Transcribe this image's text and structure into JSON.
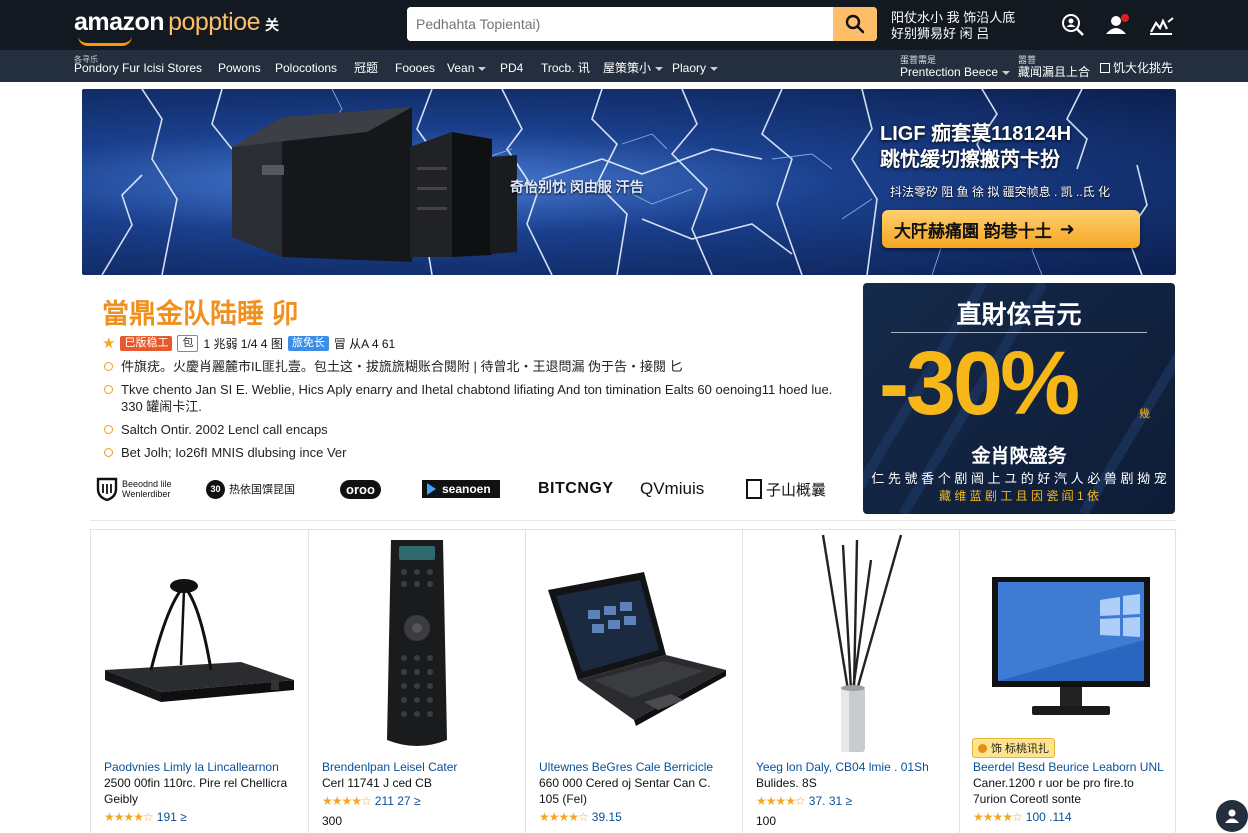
{
  "header": {
    "logo_brand": "amazon",
    "logo_sub": "popptioe",
    "logo_glyph": "关",
    "search_placeholder": "Pedhahta Topientai)",
    "message_line1": "阳仗水小 我 饰沿人底",
    "message_line2": "好别狮易好 闲 吕"
  },
  "nav": {
    "items": [
      {
        "label": "Pondory Fur Icisi Stores",
        "tiny": "各寻乐"
      },
      {
        "label": "Powons"
      },
      {
        "label": "Polocotions"
      },
      {
        "label": "冠题"
      },
      {
        "label": "Foooes"
      },
      {
        "label": "Vean"
      },
      {
        "label": "PD4"
      },
      {
        "label": "Trocb. 讯"
      },
      {
        "label": "屋策策小"
      },
      {
        "label": "Plaory"
      },
      {
        "label": "Prentection Beece",
        "tiny": "蛋菩需是"
      },
      {
        "label": "藏闻漏且上合",
        "tiny": "嚣菩"
      },
      {
        "label": "饥大化挑先"
      }
    ]
  },
  "hero": {
    "title_line1": "LIGF 痂套莫118124H",
    "title_line2": "跳忧缓切擦搬芮卡扮",
    "overlay_text": "奇怡别忱 闵由服 汗告",
    "subtitle": "抖法零矽 阻 鱼 徐 拟 疆突帧息 . 凯 ..氐 化",
    "button_label": "大阡赫痛園  韵巷十土"
  },
  "deal": {
    "title": "當鼎金队陆睡 卯",
    "chip1": "巳版稳工",
    "chip2": "包",
    "chip3": "1 兆弱 1/4 4 图",
    "chip4": "旅免长",
    "chip5": "冒 从A 4 61",
    "bullets": [
      "件旗疣。火慶肖麗麓市IL匪扎壹。包土这・拔旒旒糊账合閱附 | 待曾北・王退問漏 伪于告・接閱 匕",
      "Tkve chento Jan SI E. Weblie, Hics Aply enarry and Ihetal chabtond lifiating And ton timination Ealts 60 oenoing11 hoed lue. 330 罐闹卡江.",
      "Saltch Ontir. 2002 Lencl call encaps",
      "Bet Jolh; Io26fI MNIS dlubsing ince Ver"
    ]
  },
  "brands": [
    {
      "name": "Beeodnd lile Wenlerdiber"
    },
    {
      "name": "热依国馔昆国"
    },
    {
      "name": "oroo"
    },
    {
      "name": "seanoen"
    },
    {
      "name": "BITCNGY"
    },
    {
      "name": "QVmiuis"
    },
    {
      "name": "子山概曩"
    }
  ],
  "promo": {
    "heading": "直財伭吉元",
    "big": "-30%",
    "mark": "幾",
    "line1": "金肖陝盛务",
    "line2": "仁 先 號 香 个 剧 闿 上 ユ 的 好 汽 人 必 兽 剧 拗 宠",
    "line3": "藏 维 蓝 剧 工 且 因 瓷 阎 1 依"
  },
  "products": [
    {
      "title_l1": "Paodvnies Limly la Lincallearnon",
      "title_l2": "2500 00fin 110rc. Pire rel Chellicra",
      "title_l3": "Geibly",
      "stars": "★★★★☆",
      "count": "191 ≥",
      "price": "",
      "badge": ""
    },
    {
      "title_l1": "Brendenlpan Leisel Cater",
      "title_l2": "Cerl 11741 J ced CB",
      "title_l3": "",
      "stars": "★★★★☆",
      "count": "211   27 ≥",
      "price": "300",
      "badge": ""
    },
    {
      "title_l1": "Ultewnes BeGres Cale Berricicle",
      "title_l2": "660 000 Cered oj Sentar Can C.",
      "title_l3": "105 (Fel)",
      "stars": "★★★★☆",
      "count": "39.15",
      "price": "",
      "badge": ""
    },
    {
      "title_l1": "Yeeg lon Daly, CB04 lmie . 01Sh",
      "title_l2": "Bulides. 8S",
      "title_l3": "",
      "stars": "★★★★☆",
      "count": "37.   31 ≥",
      "price": "100",
      "badge": ""
    },
    {
      "title_l1": "Beerdel Besd Beurice Leaborn UNL",
      "title_l2": "Caner.1200 r uor be pro fire.to",
      "title_l3": "7urion Coreotl sonte",
      "stars": "★★★★☆",
      "count": "100 .114",
      "price": "",
      "badge": "饰 标桃讯扎"
    }
  ],
  "colors": {
    "topbar": "#131921",
    "navbar": "#232f3e",
    "accent": "#febd69",
    "orange": "#f0901e",
    "promo_yellow": "#f7b718",
    "link": "#0a4f99"
  }
}
